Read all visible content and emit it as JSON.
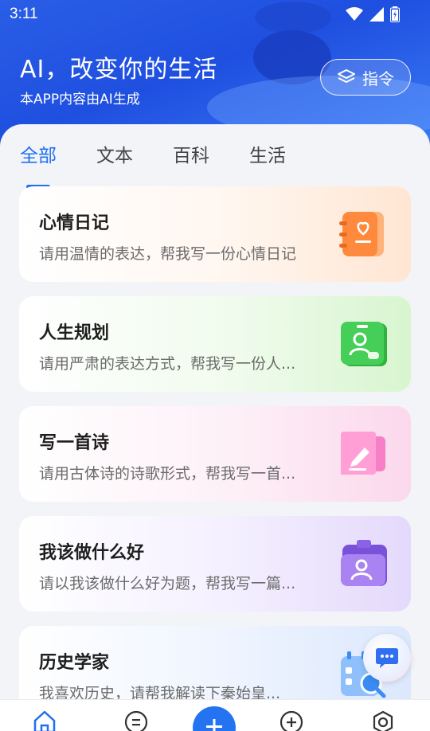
{
  "status": {
    "time": "3:11"
  },
  "header": {
    "title": "AI，改变你的生活",
    "subtitle": "本APP内容由AI生成",
    "command_label": "指令"
  },
  "tabs": [
    {
      "label": "全部",
      "active": true
    },
    {
      "label": "文本",
      "active": false
    },
    {
      "label": "百科",
      "active": false
    },
    {
      "label": "生活",
      "active": false
    }
  ],
  "cards": [
    {
      "title": "心情日记",
      "desc": "请用温情的表达，帮我写一份心情日记",
      "icon": "diary-icon",
      "color": "#ff8a3d"
    },
    {
      "title": "人生规划",
      "desc": "请用严肃的表达方式，帮我写一份人...",
      "icon": "profile-card-icon",
      "color": "#3cc44f"
    },
    {
      "title": "写一首诗",
      "desc": "请用古体诗的诗歌形式，帮我写一首...",
      "icon": "pen-note-icon",
      "color": "#f05ab4"
    },
    {
      "title": "我该做什么好",
      "desc": "请以我该做什么好为题，帮我写一篇...",
      "icon": "clipboard-user-icon",
      "color": "#8a62e8"
    },
    {
      "title": "历史学家",
      "desc": "我喜欢历史，请帮我解读下秦始皇...",
      "icon": "search-calendar-icon",
      "color": "#3b8cf2"
    }
  ],
  "bottom_nav": [
    {
      "name": "home",
      "icon": "home-icon",
      "active": true
    },
    {
      "name": "messages",
      "icon": "chat-lines-icon",
      "active": false
    },
    {
      "name": "create",
      "icon": "plus-icon",
      "active": false
    },
    {
      "name": "add",
      "icon": "plus-circle-icon",
      "active": false
    },
    {
      "name": "profile",
      "icon": "settings-ring-icon",
      "active": false
    }
  ],
  "colors": {
    "accent": "#1f6ff0",
    "header": "#2a5ee6"
  }
}
